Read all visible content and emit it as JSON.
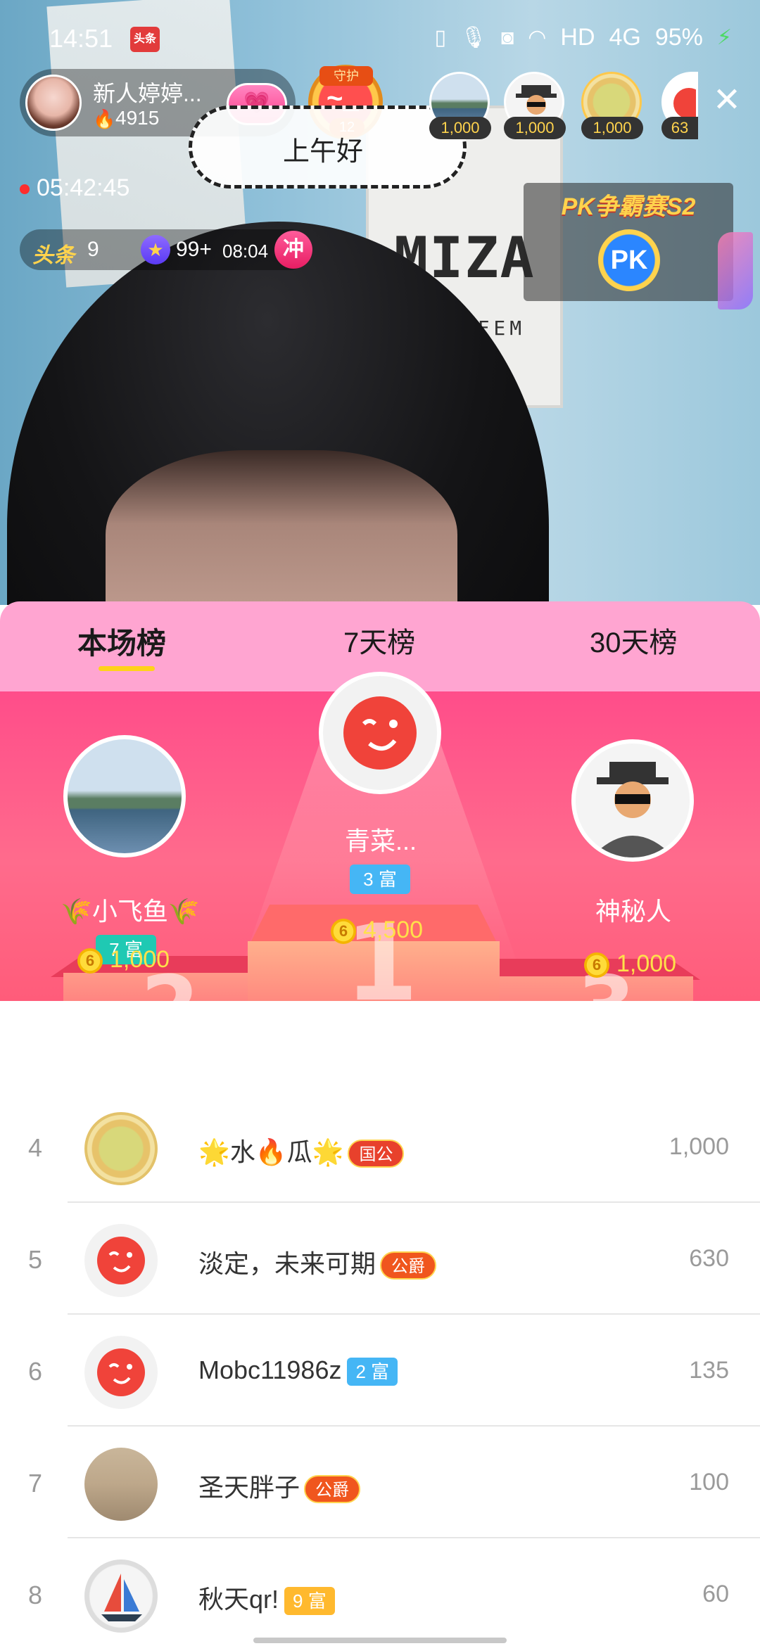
{
  "status_bar": {
    "time": "14:51",
    "app_icon_label": "头条",
    "indicators": [
      "HD",
      "4G"
    ],
    "battery": "95%"
  },
  "host": {
    "name": "新人婷婷...",
    "heat": "4915",
    "follow_icon": "heart-wings-icon"
  },
  "guard": {
    "tag": "守护",
    "level": "12"
  },
  "greeting": "上午好",
  "viewers": [
    {
      "amount": "1,000",
      "avatar": "lake"
    },
    {
      "amount": "1,000",
      "avatar": "spy"
    },
    {
      "amount": "1,000",
      "avatar": "apple"
    },
    {
      "amount": "63",
      "avatar": "red"
    }
  ],
  "live_timer": "05:42:45",
  "info_bar": {
    "toutiao_label": "头条",
    "toutiao_count": "9",
    "star_count": "99+",
    "star_time": "08:04",
    "rush_label": "冲"
  },
  "pk": {
    "title": "PK争霸赛S2",
    "button_label": "PK"
  },
  "tabs": [
    {
      "label": "本场榜",
      "active": true
    },
    {
      "label": "7天榜",
      "active": false
    },
    {
      "label": "30天榜",
      "active": false
    }
  ],
  "podium": {
    "first": {
      "name": "青菜...",
      "badge": "3 富",
      "amount": "4,500",
      "place_label": "1"
    },
    "second": {
      "name": "🌾小飞鱼🌾",
      "badge": "7 富",
      "amount": "1,000",
      "place_label": "2"
    },
    "third": {
      "name": "神秘人",
      "amount": "1,000",
      "place_label": "3"
    }
  },
  "coin_label": "6",
  "ranking": [
    {
      "rank": "4",
      "name": "🌟水🔥瓜🌟",
      "badge": "国公",
      "badge_type": "noble",
      "value": "1,000",
      "avatar": "apple"
    },
    {
      "rank": "5",
      "name": "淡定，未来可期",
      "badge": "公爵",
      "badge_type": "noble",
      "value": "630",
      "avatar": "red"
    },
    {
      "rank": "6",
      "name": "Mobc11986z",
      "badge": "2 富",
      "badge_type": "wealth-blue",
      "value": "135",
      "avatar": "red"
    },
    {
      "rank": "7",
      "name": "圣天胖子",
      "badge": "公爵",
      "badge_type": "noble",
      "value": "100",
      "avatar": "sand"
    },
    {
      "rank": "8",
      "name": "秋天qr!",
      "badge": "9 富",
      "badge_type": "wealth-gold",
      "value": "60",
      "avatar": "egg"
    }
  ],
  "colors": {
    "tab_bg": "#ffa5d1",
    "podium_bg": "#ff4d8a",
    "coin_text": "#ffe14a",
    "rich_teal": "#1fc9b3",
    "rich_blue": "#45b6f5",
    "rich_gold": "#ffb92e",
    "noble_red": "#e8412c"
  }
}
